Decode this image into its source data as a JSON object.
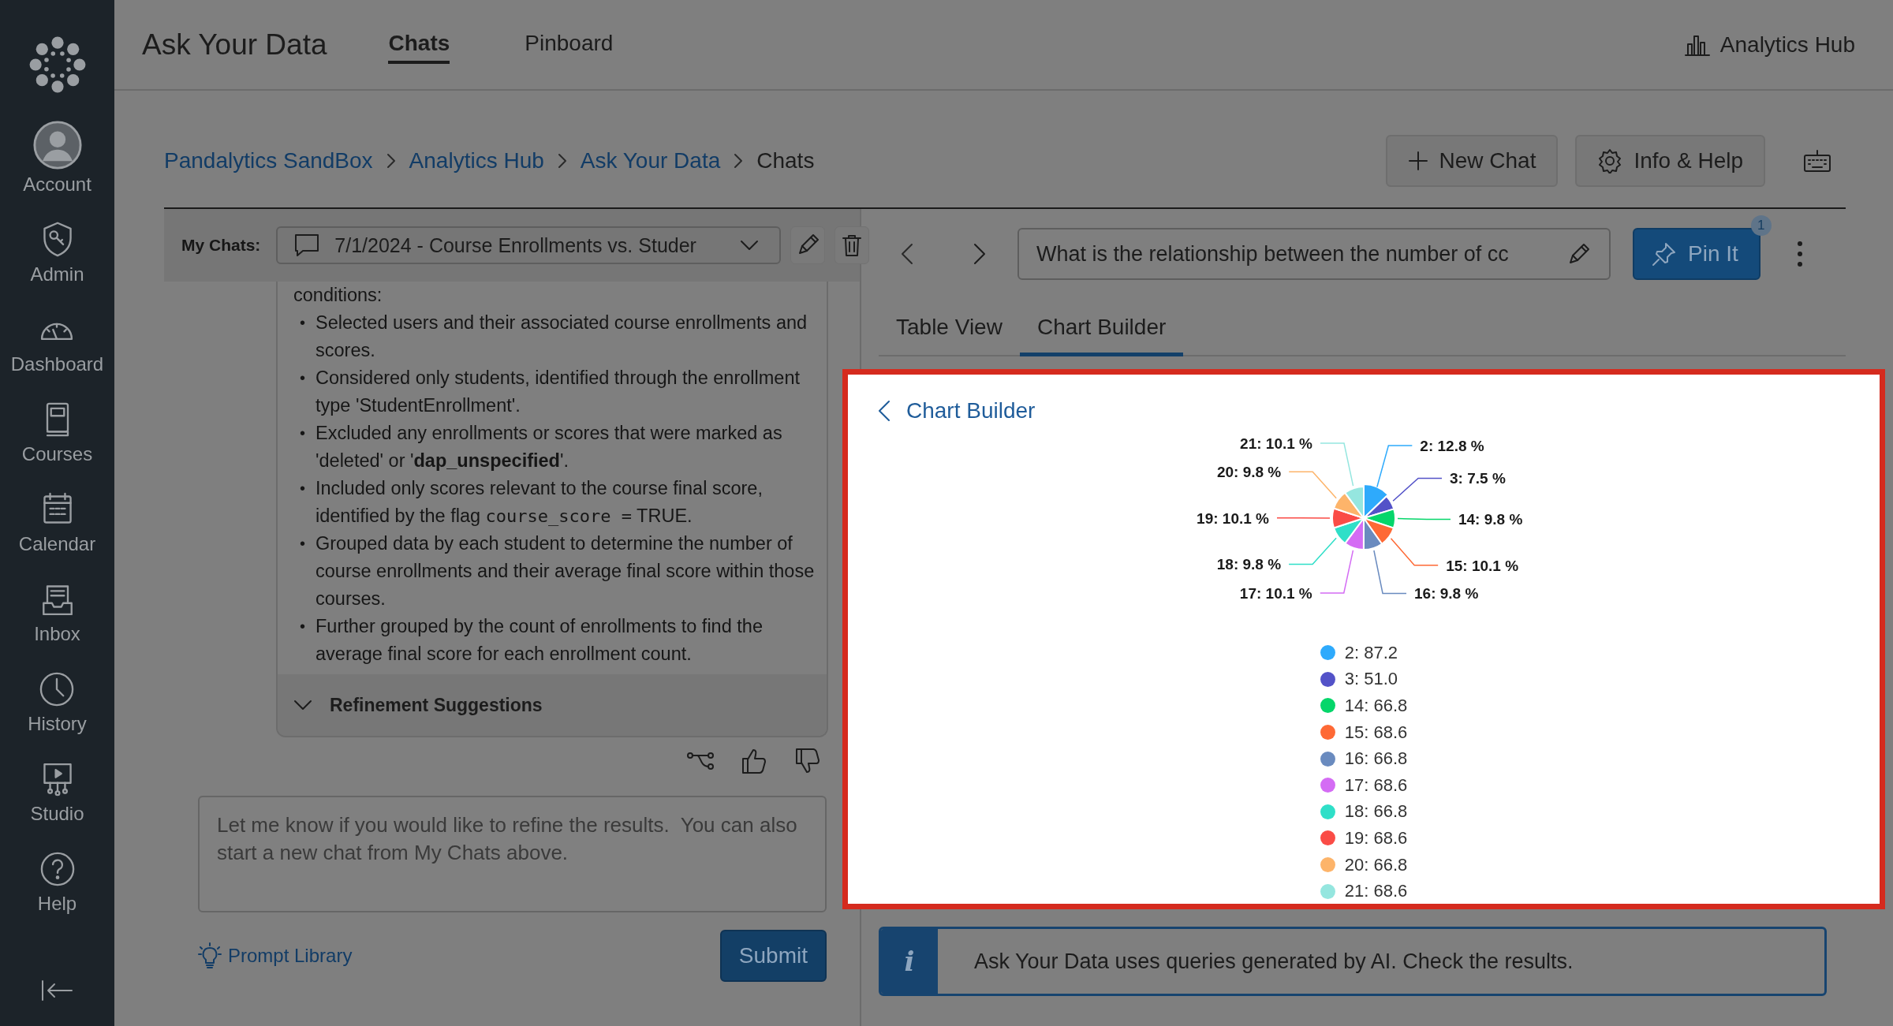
{
  "sidebar": {
    "items": [
      {
        "label": "Account"
      },
      {
        "label": "Admin"
      },
      {
        "label": "Dashboard"
      },
      {
        "label": "Courses"
      },
      {
        "label": "Calendar"
      },
      {
        "label": "Inbox"
      },
      {
        "label": "History"
      },
      {
        "label": "Studio"
      },
      {
        "label": "Help"
      }
    ]
  },
  "header": {
    "title": "Ask Your Data",
    "tabs": [
      {
        "label": "Chats",
        "selected": true
      },
      {
        "label": "Pinboard",
        "selected": false
      }
    ],
    "hub_link": "Analytics Hub"
  },
  "breadcrumb": [
    "Pandalytics SandBox",
    "Analytics Hub",
    "Ask Your Data",
    "Chats"
  ],
  "actions": [
    "New Chat",
    "Info & Help"
  ],
  "chat_panel": {
    "label": "My Chats:",
    "selected_chat": "7/1/2024 - Course Enrollments vs. Studer",
    "intro": "conditions:",
    "marker": "•",
    "bullets": [
      {
        "parts": [
          {
            "text": "Selected users and their associated course enrollments and scores."
          }
        ]
      },
      {
        "parts": [
          {
            "text": "Considered only students, identified through the enrollment type 'StudentEnrollment'."
          }
        ]
      },
      {
        "parts": [
          {
            "text": "Excluded any enrollments or scores that were marked as 'deleted' or '**dap_unspecified**'."
          }
        ]
      },
      {
        "parts": [
          {
            "text": "Included only scores relevant to the course final score, identified by the flag "
          },
          {
            "kind": "code",
            "text": "course_score ="
          },
          {
            "text": " TRUE."
          }
        ]
      },
      {
        "parts": [
          {
            "text": "Grouped data by each student to determine the number of course enrollments and their average final score within those courses."
          }
        ]
      },
      {
        "parts": [
          {
            "text": "Further grouped by the count of enrollments to find the average final score for each enrollment count."
          }
        ]
      }
    ],
    "refinement": "Refinement Suggestions",
    "input": {
      "placeholder": "Let me know if you would like to refine the results.  You can also start a new chat from My Chats above."
    },
    "prompt_library": "Prompt Library",
    "submit": "Submit"
  },
  "result_panel": {
    "question": "What is the relationship between the number of cc",
    "pin": {
      "label": "Pin It",
      "count": "1"
    },
    "tabs": [
      {
        "label": "Table View",
        "selected": false
      },
      {
        "label": "Chart Builder",
        "selected": true
      }
    ],
    "chart_panel": {
      "back_label": "Chart Builder",
      "chart_data": {
        "type": "pie",
        "categories": [
          "2: 12.8 %",
          "3: 7.5 %",
          "14: 9.8 %",
          "15: 10.1 %",
          "16: 9.8 %",
          "17: 10.1 %",
          "18: 9.8 %",
          "19: 10.1 %",
          "20: 9.8 %",
          "21: 10.1 %"
        ],
        "values": [
          12.8,
          7.5,
          9.8,
          10.1,
          9.8,
          10.1,
          9.8,
          10.1,
          9.8,
          10.1
        ]
      },
      "legend": [
        {
          "label": "2: 87.2",
          "color": "#2eaafc"
        },
        {
          "label": "3: 51.0",
          "color": "#5352c8"
        },
        {
          "label": "14: 66.8",
          "color": "#05d66a"
        },
        {
          "label": "15: 68.6",
          "color": "#fe6935"
        },
        {
          "label": "16: 66.8",
          "color": "#6a8bbf"
        },
        {
          "label": "17: 68.6",
          "color": "#d46cf4"
        },
        {
          "label": "18: 66.8",
          "color": "#2fdfc8"
        },
        {
          "label": "19: 68.6",
          "color": "#fa4c46"
        },
        {
          "label": "20: 66.8",
          "color": "#fdb46a"
        },
        {
          "label": "21: 68.6",
          "color": "#95e6df"
        }
      ]
    },
    "notice_icon": "i",
    "notice": "Ask Your Data uses queries generated by AI. Check the results."
  }
}
